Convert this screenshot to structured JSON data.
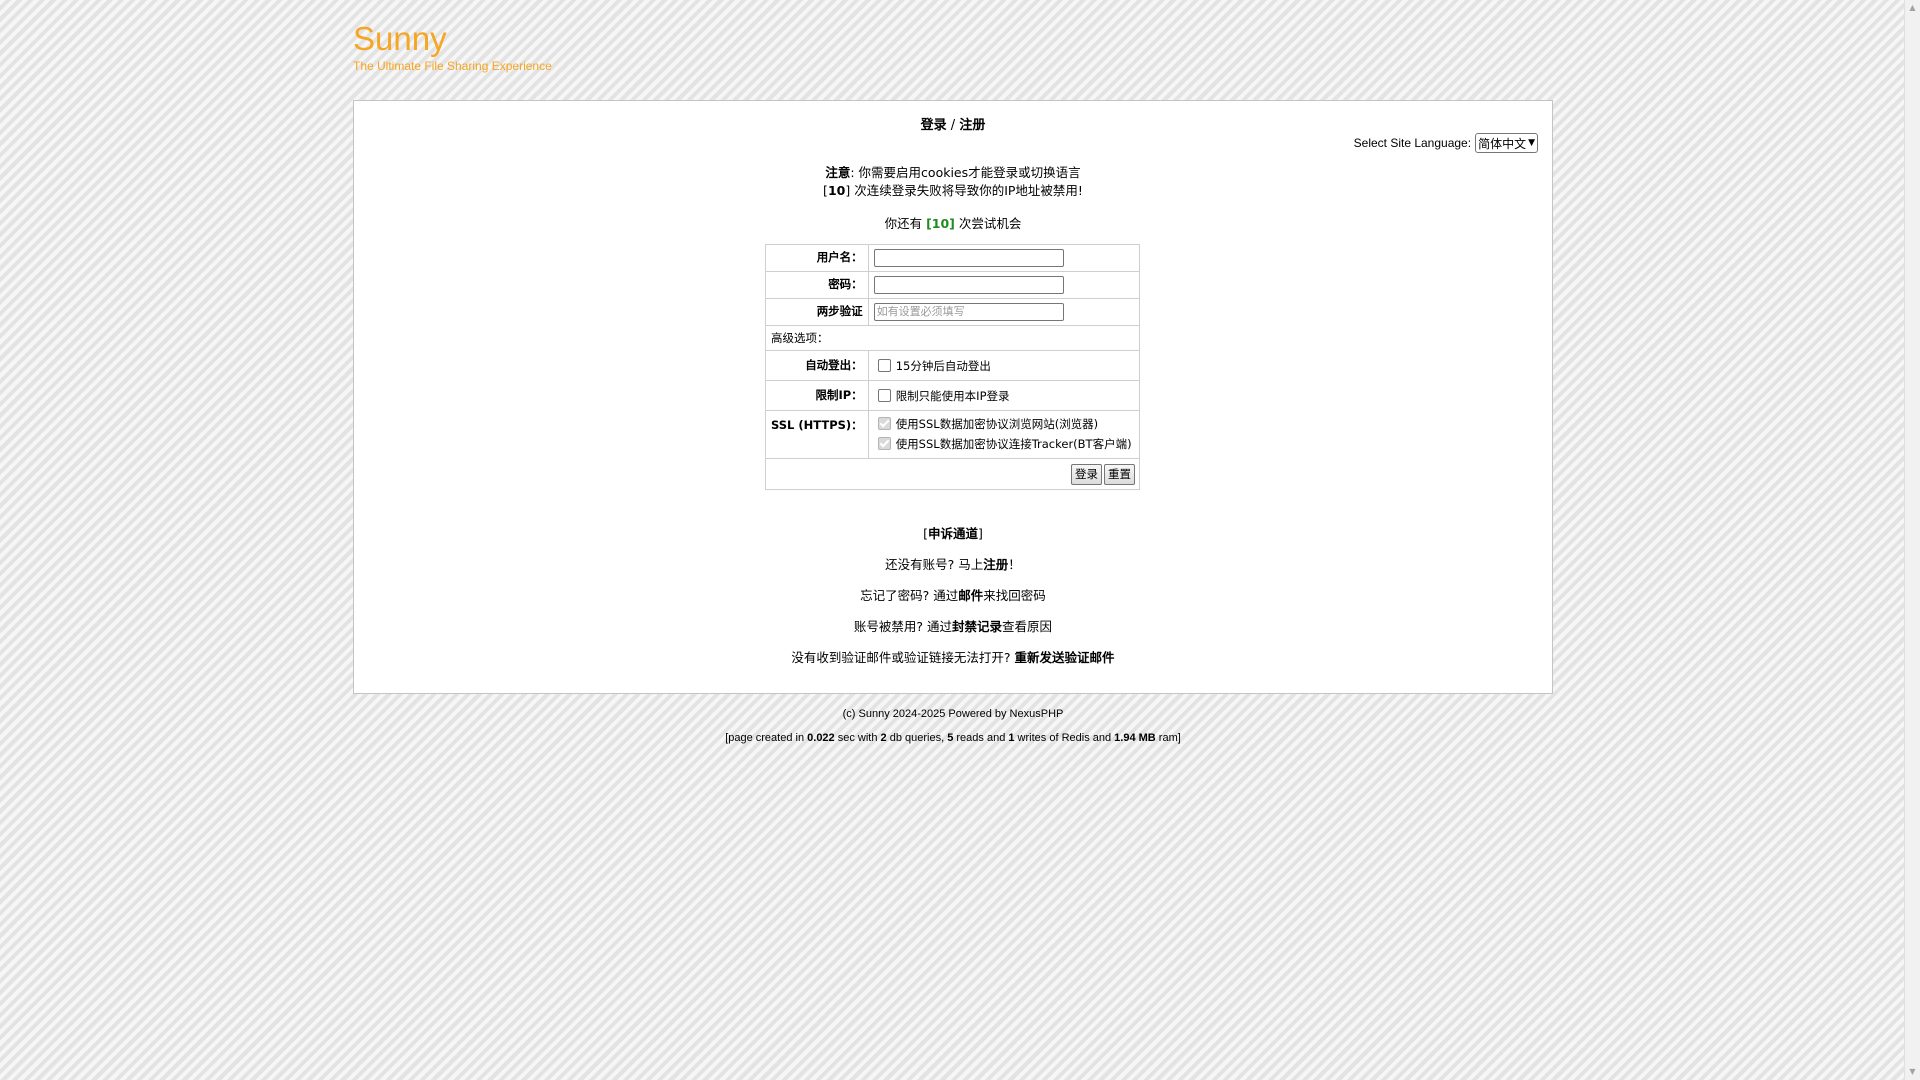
{
  "header": {
    "site_title": "Sunny",
    "slogan": "The Ultimate File Sharing Experience"
  },
  "colors": {
    "brand": "#f5a623",
    "attempts": "#1e8c1e"
  },
  "login_box": {
    "title_left": "登录",
    "title_sep": " / ",
    "title_right": "注册",
    "language_label": "Select Site Language:",
    "language_selected": "简体中文",
    "notice_label": "注意",
    "notice_text": ": 你需要启用cookies才能登录或切换语言",
    "fail_count": "10",
    "fail_text": " 次连续登录失败将导致你的IP地址被禁用!",
    "remaining_prefix": "你还有 ",
    "remaining_count": "[10]",
    "remaining_suffix": " 次尝试机会"
  },
  "form": {
    "username_label": "用户名：",
    "username_value": "",
    "password_label": "密码：",
    "password_value": "",
    "twofa_label": "两步验证",
    "twofa_placeholder": "如有设置必须填写",
    "advanced_label": "高级选项：",
    "autologout_label": "自动登出：",
    "autologout_text": "15分钟后自动登出",
    "restrict_ip_label": "限制IP：",
    "restrict_ip_text": "限制只能使用本IP登录",
    "ssl_label": "SSL (HTTPS)：",
    "ssl_browse_text": "使用SSL数据加密协议浏览网站(浏览器)",
    "ssl_tracker_text": "使用SSL数据加密协议连接Tracker(BT客户端)",
    "login_button": "登录",
    "reset_button": "重置"
  },
  "links": {
    "appeal": "申诉通道",
    "no_account_prefix": "还没有账号? 马上",
    "register": "注册",
    "no_account_suffix": "！",
    "forgot_prefix": "忘记了密码? 通过",
    "forgot_email": "邮件",
    "forgot_suffix": "来找回密码",
    "banned_prefix": "账号被禁用? 通过",
    "banned_log": "封禁记录",
    "banned_suffix": "查看原因",
    "no_email_prefix": "没有收到验证邮件或验证链接无法打开?",
    "resend": "重新发送验证邮件"
  },
  "footer": {
    "copyright": "(c) Sunny 2024-2025 Powered by NexusPHP",
    "stats_prefix": "[page created in ",
    "time": "0.022",
    "t1": " sec with ",
    "db": "2",
    "t2": " db queries, ",
    "reads": "5",
    "t3": " reads and ",
    "writes": "1",
    "t4": " writes of Redis and ",
    "ram": "1.94 MB",
    "t5": " ram]"
  }
}
